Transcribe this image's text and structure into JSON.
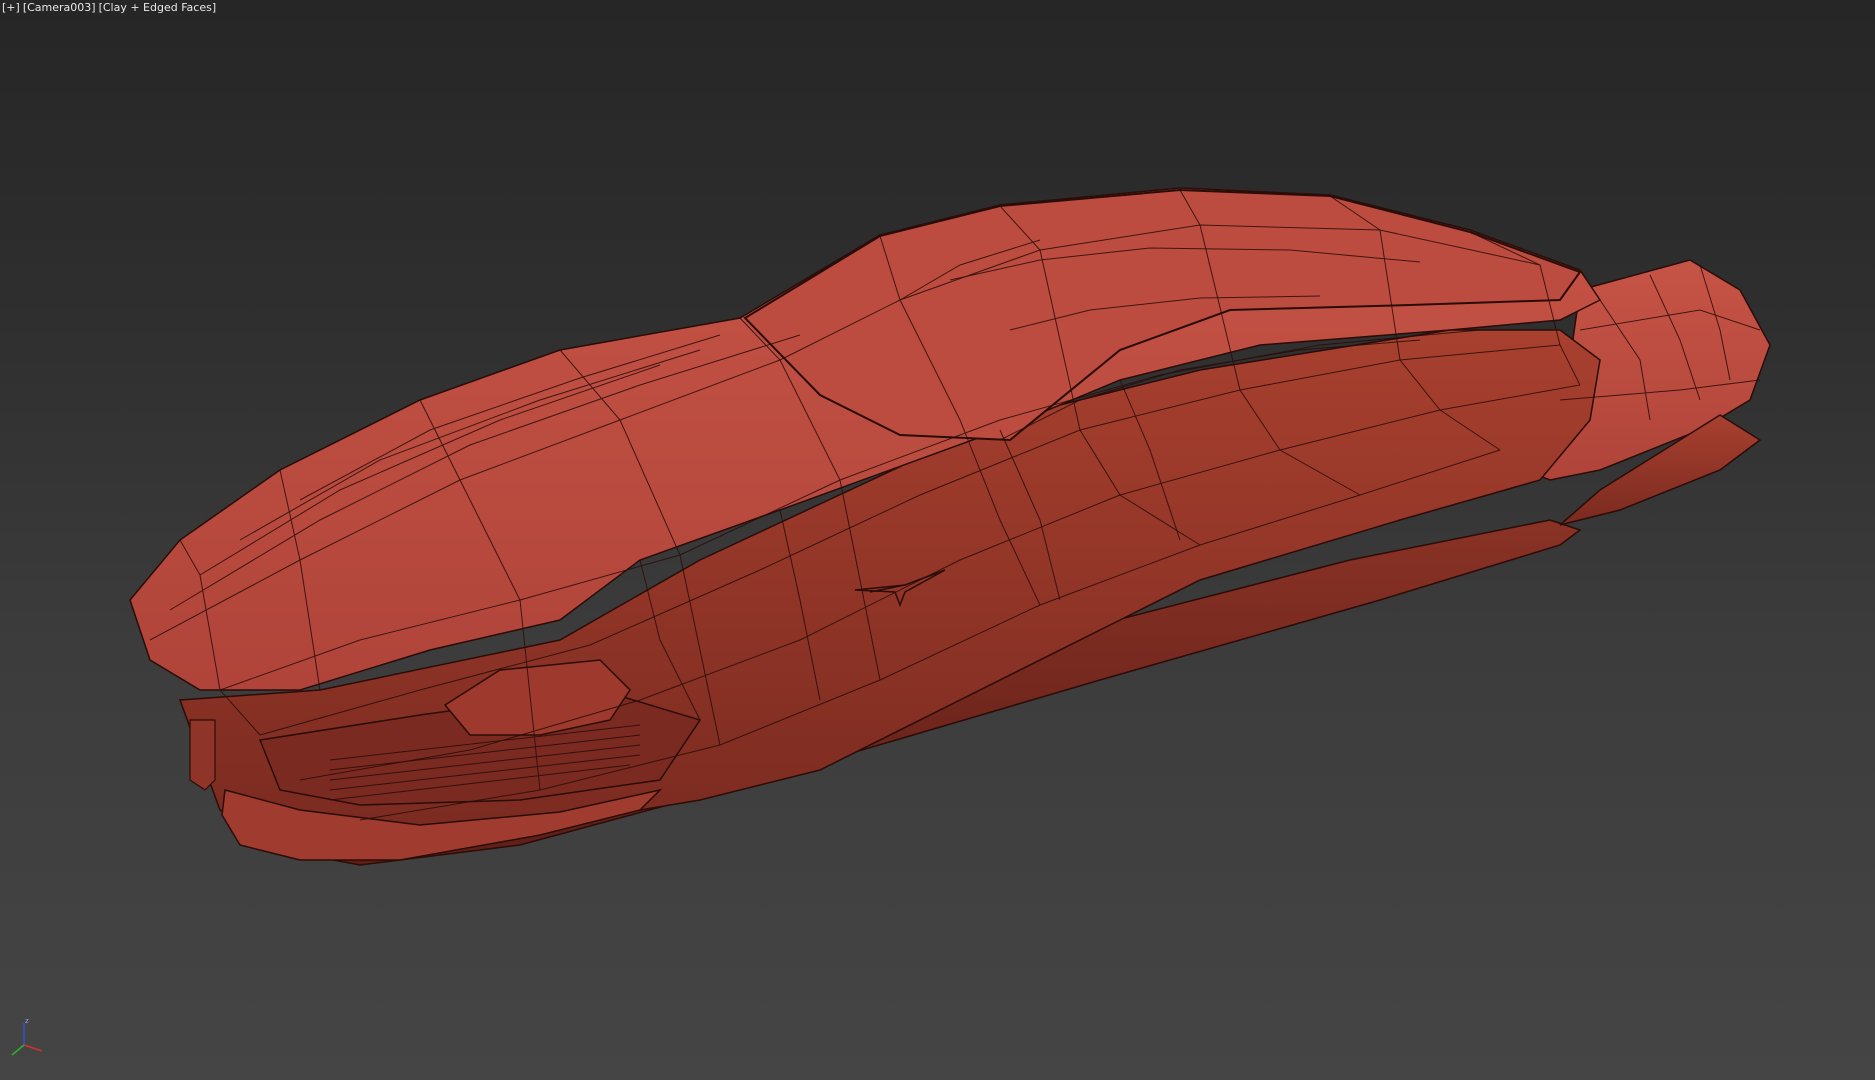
{
  "viewport": {
    "menu_plus": "[+]",
    "camera": "[Camera003]",
    "shading": "[Clay + Edged Faces]",
    "background_color": "#2f2f2f",
    "model_color": "#b8473a",
    "edge_color": "#2a0c08"
  },
  "gizmo": {
    "name": "axis-tripod",
    "x_color": "#d03030",
    "y_color": "#30b030",
    "z_color": "#3050d0",
    "z_label": "z"
  }
}
